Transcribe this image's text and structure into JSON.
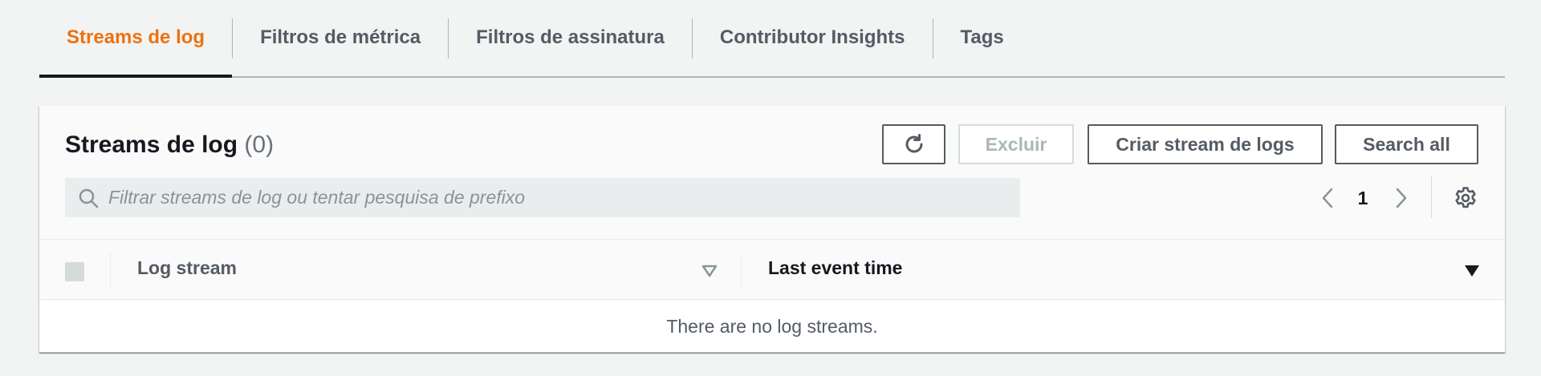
{
  "tabs": [
    {
      "label": "Streams de log",
      "active": true
    },
    {
      "label": "Filtros de métrica",
      "active": false
    },
    {
      "label": "Filtros de assinatura",
      "active": false
    },
    {
      "label": "Contributor Insights",
      "active": false
    },
    {
      "label": "Tags",
      "active": false
    }
  ],
  "panel": {
    "title": "Streams de log",
    "count": "(0)",
    "buttons": {
      "refresh_icon": "refresh-icon",
      "delete": "Excluir",
      "create": "Criar stream de logs",
      "search_all": "Search all"
    },
    "search": {
      "placeholder": "Filtrar streams de log ou tentar pesquisa de prefixo",
      "value": ""
    },
    "pagination": {
      "current_page": "1"
    }
  },
  "table": {
    "columns": [
      "Log stream",
      "Last event time"
    ],
    "empty_message": "There are no log streams."
  },
  "colors": {
    "accent": "#ec7211",
    "text": "#16191f",
    "muted": "#545b64",
    "background": "#f2f3f3"
  }
}
